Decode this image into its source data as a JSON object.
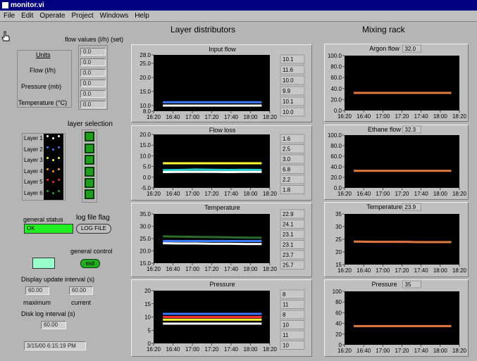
{
  "window": {
    "title": "monitor.vi"
  },
  "menu": [
    "File",
    "Edit",
    "Operate",
    "Project",
    "Windows",
    "Help"
  ],
  "left": {
    "flow_values_label": "flow values (l/h) (set)",
    "units_label": "Units",
    "unit_rows": [
      "Flow (l/h)",
      "Pressure (mb)",
      "Temperature (°C)"
    ],
    "flow_values": [
      "0.0",
      "0.0",
      "0.0",
      "0.0",
      "0.0",
      "0.0"
    ],
    "layer_selection_label": "layer selection",
    "layers": [
      "Layer 1",
      "Layer 2",
      "Layer 3",
      "Layer 4",
      "Layer 5",
      "Layer 6"
    ],
    "layer_dot_colors": [
      "#ffffff",
      "#3a7bff",
      "#ffff33",
      "#ffa020",
      "#ff3030",
      "#22aa22"
    ],
    "general_status_label": "general status",
    "general_status_value": "OK",
    "log_file_flag_label": "log file flag",
    "log_file_button": "LOG FILE",
    "general_control_label": "general control",
    "general_control_button": "exit",
    "display_update_label": "Display update interval (s)",
    "maximum_value": "60.00",
    "maximum_label": "maximum",
    "current_value": "60.00",
    "current_label": "current",
    "disk_log_label": "Disk log interval (s)",
    "disk_log_value": "60.00",
    "datetime": "3/15/00 6:15:19 PM"
  },
  "headings": {
    "layer": "Layer distributors",
    "mixing": "Mixing rack"
  },
  "x_ticks": [
    "16:20",
    "16:40",
    "17:00",
    "17:20",
    "17:40",
    "18:00",
    "18:20"
  ],
  "chart_data": [
    {
      "type": "line",
      "title": "Input flow",
      "ylim": [
        8,
        28
      ],
      "yticks": [
        "28.0",
        "25.0",
        "20.0",
        "15.0",
        "10.0",
        "8.0"
      ],
      "ytick_vals": [
        28,
        25,
        20,
        15,
        10,
        8
      ],
      "series": [
        {
          "color": "#3a7bff",
          "values": [
            11.2,
            11.2,
            11.2,
            11.2,
            11.2,
            11.2,
            11.2
          ]
        },
        {
          "color": "#ffffff",
          "values": [
            10.0,
            10.0,
            10.0,
            10.0,
            10.0,
            10.0,
            10.0
          ]
        }
      ],
      "readouts": [
        "10.1",
        "11.6",
        "10.0",
        "9.9",
        "10.1",
        "10.0"
      ]
    },
    {
      "type": "line",
      "title": "Flow loss",
      "ylim": [
        -5,
        20
      ],
      "yticks": [
        "20.0",
        "15.0",
        "10.0",
        "5.0",
        "0.0",
        "-5.0"
      ],
      "ytick_vals": [
        20,
        15,
        10,
        5,
        0,
        -5
      ],
      "series": [
        {
          "color": "#ffff33",
          "values": [
            6.5,
            6.5,
            6.5,
            6.5,
            6.5,
            6.5,
            6.5
          ]
        },
        {
          "color": "#22cccc",
          "values": [
            3.3,
            3.4,
            3.6,
            3.5,
            3.4,
            3.5,
            3.4
          ]
        },
        {
          "color": "#ffffff",
          "values": [
            2.4,
            2.5,
            2.5,
            2.5,
            2.4,
            2.5,
            2.5
          ]
        }
      ],
      "readouts": [
        "1.6",
        "2.5",
        "3.0",
        "6.8",
        "2.2",
        "1.8"
      ]
    },
    {
      "type": "line",
      "title": "Temperature",
      "ylim": [
        15,
        35
      ],
      "yticks": [
        "35.0",
        "30.0",
        "25.0",
        "20.0",
        "15.0"
      ],
      "ytick_vals": [
        35,
        30,
        25,
        20,
        15
      ],
      "series": [
        {
          "color": "#2d6b2d",
          "values": [
            25.9,
            25.8,
            25.7,
            25.6,
            25.5,
            25.4,
            25.3
          ]
        },
        {
          "color": "#3a7bff",
          "values": [
            24.0,
            24.0,
            24.0,
            24.0,
            24.0,
            24.0,
            24.0
          ]
        },
        {
          "color": "#ffffff",
          "values": [
            23.1,
            23.0,
            23.0,
            22.9,
            22.9,
            22.8,
            22.8
          ]
        }
      ],
      "readouts": [
        "22.9",
        "24.1",
        "23.1",
        "23.1",
        "23.7",
        "25.7"
      ]
    },
    {
      "type": "line",
      "title": "Pressure",
      "ylim": [
        0,
        20
      ],
      "yticks": [
        "20",
        "15",
        "10",
        "5",
        "0"
      ],
      "ytick_vals": [
        20,
        15,
        10,
        5,
        0
      ],
      "series": [
        {
          "color": "#3a7bff",
          "values": [
            11.2,
            11.2,
            11.2,
            11.2,
            11.2,
            11.2,
            11.2
          ]
        },
        {
          "color": "#ff3030",
          "values": [
            10.0,
            10.0,
            10.0,
            10.0,
            10.0,
            10.0,
            10.0
          ]
        },
        {
          "color": "#ffff33",
          "values": [
            9.0,
            9.0,
            9.0,
            9.0,
            9.0,
            9.0,
            9.0
          ]
        },
        {
          "color": "#ffffff",
          "values": [
            7.5,
            7.5,
            7.5,
            7.5,
            7.5,
            7.5,
            7.5
          ]
        }
      ],
      "readouts": [
        "8",
        "11",
        "8",
        "10",
        "11",
        "10"
      ]
    },
    {
      "type": "line",
      "title": "Argon flow",
      "readout": "32.0",
      "ylim": [
        0,
        100
      ],
      "yticks": [
        "100.0",
        "80.0",
        "60.0",
        "40.0",
        "20.0",
        "0.0"
      ],
      "ytick_vals": [
        100,
        80,
        60,
        40,
        20,
        0
      ],
      "series": [
        {
          "color": "#e07840",
          "values": [
            32,
            32,
            32,
            32,
            32,
            32,
            32
          ]
        }
      ]
    },
    {
      "type": "line",
      "title": "Ethane flow",
      "readout": "32.3",
      "ylim": [
        0,
        100
      ],
      "yticks": [
        "100.0",
        "80.0",
        "60.0",
        "40.0",
        "20.0",
        "0.0"
      ],
      "ytick_vals": [
        100,
        80,
        60,
        40,
        20,
        0
      ],
      "series": [
        {
          "color": "#e07840",
          "values": [
            32.3,
            32.3,
            32.3,
            32.3,
            32.3,
            32.3,
            32.3
          ]
        }
      ]
    },
    {
      "type": "line",
      "title": "Temperature",
      "readout": "23.9",
      "ylim": [
        15,
        35
      ],
      "yticks": [
        "35",
        "30",
        "25",
        "20",
        "15"
      ],
      "ytick_vals": [
        35,
        30,
        25,
        20,
        15
      ],
      "series": [
        {
          "color": "#e07840",
          "values": [
            24.1,
            24.0,
            24.0,
            24.0,
            23.9,
            23.9,
            23.9
          ]
        }
      ]
    },
    {
      "type": "line",
      "title": "Pressure",
      "readout": "35",
      "ylim": [
        0,
        100
      ],
      "yticks": [
        "100",
        "80",
        "60",
        "40",
        "20",
        "0"
      ],
      "ytick_vals": [
        100,
        80,
        60,
        40,
        20,
        0
      ],
      "series": [
        {
          "color": "#e07840",
          "values": [
            35,
            35,
            35,
            35,
            35,
            35,
            35
          ]
        }
      ]
    }
  ]
}
